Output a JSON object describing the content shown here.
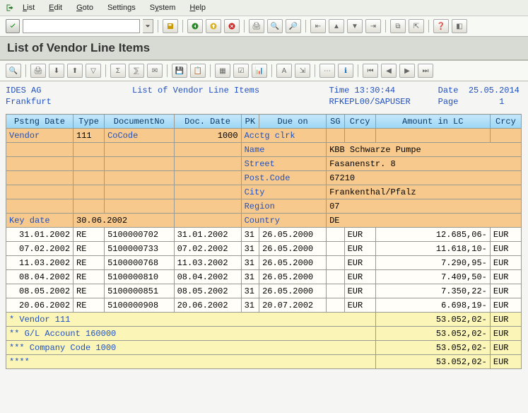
{
  "menu": {
    "list": "List",
    "edit": "Edit",
    "goto": "Goto",
    "settings": "Settings",
    "system": "System",
    "help": "Help"
  },
  "title": "List of Vendor Line Items",
  "rh": {
    "company": "IDES AG",
    "city": "Frankfurt",
    "title": "List of Vendor Line Items",
    "time_lbl": "Time",
    "time": "13:30:44",
    "date_lbl": "Date",
    "date": "25.05.2014",
    "prog": "RFKEPL00/SAPUSER",
    "page_lbl": "Page",
    "page": "1"
  },
  "cols": {
    "pstng": "Pstng Date",
    "type": "Type",
    "docno": "DocumentNo",
    "docdate": "Doc. Date",
    "pk": "PK",
    "due": "Due on",
    "sg": "SG",
    "crcy": "Crcy",
    "amt": "Amount in LC",
    "crcy2": "Crcy"
  },
  "vendor": {
    "lbl": "Vendor",
    "no": "111",
    "cocode_lbl": "CoCode",
    "cocode": "1000",
    "acct": "Acctg clrk",
    "name_lbl": "Name",
    "name": "KBB Schwarze Pumpe",
    "street_lbl": "Street",
    "street": "Fasanenstr. 8",
    "post_lbl": "Post.Code",
    "post": "67210",
    "city_lbl": "City",
    "cityv": "Frankenthal/Pfalz",
    "region_lbl": "Region",
    "region": "07",
    "keydate_lbl": "Key date",
    "keydate": "30.06.2002",
    "country_lbl": "Country",
    "country": "DE"
  },
  "items": [
    {
      "pstng": "31.01.2002",
      "type": "RE",
      "docno": "5100000702",
      "docdate": "31.01.2002",
      "pk": "31",
      "due": "26.05.2000",
      "sg": "",
      "crcy": "EUR",
      "amt": "12.685,06-",
      "crcy2": "EUR"
    },
    {
      "pstng": "07.02.2002",
      "type": "RE",
      "docno": "5100000733",
      "docdate": "07.02.2002",
      "pk": "31",
      "due": "26.05.2000",
      "sg": "",
      "crcy": "EUR",
      "amt": "11.618,10-",
      "crcy2": "EUR"
    },
    {
      "pstng": "11.03.2002",
      "type": "RE",
      "docno": "5100000768",
      "docdate": "11.03.2002",
      "pk": "31",
      "due": "26.05.2000",
      "sg": "",
      "crcy": "EUR",
      "amt": "7.290,95-",
      "crcy2": "EUR"
    },
    {
      "pstng": "08.04.2002",
      "type": "RE",
      "docno": "5100000810",
      "docdate": "08.04.2002",
      "pk": "31",
      "due": "26.05.2000",
      "sg": "",
      "crcy": "EUR",
      "amt": "7.409,50-",
      "crcy2": "EUR"
    },
    {
      "pstng": "08.05.2002",
      "type": "RE",
      "docno": "5100000851",
      "docdate": "08.05.2002",
      "pk": "31",
      "due": "26.05.2000",
      "sg": "",
      "crcy": "EUR",
      "amt": "7.350,22-",
      "crcy2": "EUR"
    },
    {
      "pstng": "20.06.2002",
      "type": "RE",
      "docno": "5100000908",
      "docdate": "20.06.2002",
      "pk": "31",
      "due": "20.07.2002",
      "sg": "",
      "crcy": "EUR",
      "amt": "6.698,19-",
      "crcy2": "EUR"
    }
  ],
  "totals": [
    {
      "label": "*   Vendor 111",
      "amt": "53.052,02-",
      "crcy": "EUR"
    },
    {
      "label": "**  G/L Account 160000",
      "amt": "53.052,02-",
      "crcy": "EUR"
    },
    {
      "label": "*** Company Code 1000",
      "amt": "53.052,02-",
      "crcy": "EUR"
    },
    {
      "label": "****",
      "amt": "53.052,02-",
      "crcy": "EUR"
    }
  ]
}
